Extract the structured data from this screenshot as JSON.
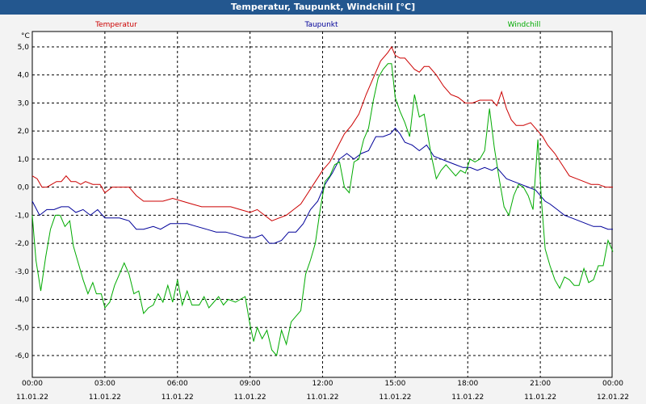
{
  "window": {
    "title": "Temperatur, Taupunkt, Windchill [°C]"
  },
  "colors": {
    "titlebar": "#23578f",
    "plot_bg": "#ffffff",
    "grid": "#000000"
  },
  "chart_data": {
    "type": "line",
    "title": "Temperatur, Taupunkt, Windchill [°C]",
    "unit": "°C",
    "ylim": [
      -6.5,
      5.3
    ],
    "y_ticks": [
      "5,0",
      "4,0",
      "3,0",
      "2,0",
      "1,0",
      "0,0",
      "-1,0",
      "-2,0",
      "-3,0",
      "-4,0",
      "-5,0",
      "-6,0"
    ],
    "y_tick_values": [
      5,
      4,
      3,
      2,
      1,
      0,
      -1,
      -2,
      -3,
      -4,
      -5,
      -6
    ],
    "x_range_hours": [
      0,
      24
    ],
    "x_ticks": [
      {
        "hours": 0,
        "time": "00:00",
        "date": "11.01.22"
      },
      {
        "hours": 3,
        "time": "03:00",
        "date": "11.01.22"
      },
      {
        "hours": 6,
        "time": "06:00",
        "date": "11.01.22"
      },
      {
        "hours": 9,
        "time": "09:00",
        "date": "11.01.22"
      },
      {
        "hours": 12,
        "time": "12:00",
        "date": "11.01.22"
      },
      {
        "hours": 15,
        "time": "15:00",
        "date": "11.01.22"
      },
      {
        "hours": 18,
        "time": "18:00",
        "date": "11.01.22"
      },
      {
        "hours": 21,
        "time": "21:00",
        "date": "11.01.22"
      },
      {
        "hours": 24,
        "time": "00:00",
        "date": "12.01.22"
      }
    ],
    "grid": true,
    "legend_position": "top",
    "series": [
      {
        "name": "Temperatur",
        "color": "#cc0000",
        "points": [
          [
            0,
            0.4
          ],
          [
            0.2,
            0.3
          ],
          [
            0.4,
            0.0
          ],
          [
            0.6,
            0.0
          ],
          [
            0.8,
            0.1
          ],
          [
            1.0,
            0.2
          ],
          [
            1.2,
            0.2
          ],
          [
            1.4,
            0.4
          ],
          [
            1.6,
            0.2
          ],
          [
            1.8,
            0.2
          ],
          [
            2.0,
            0.1
          ],
          [
            2.2,
            0.2
          ],
          [
            2.5,
            0.1
          ],
          [
            2.8,
            0.1
          ],
          [
            3.0,
            -0.2
          ],
          [
            3.3,
            0.0
          ],
          [
            3.6,
            0.0
          ],
          [
            4.0,
            0.0
          ],
          [
            4.3,
            -0.3
          ],
          [
            4.6,
            -0.5
          ],
          [
            5.0,
            -0.5
          ],
          [
            5.4,
            -0.5
          ],
          [
            5.8,
            -0.4
          ],
          [
            6.2,
            -0.5
          ],
          [
            6.6,
            -0.6
          ],
          [
            7.0,
            -0.7
          ],
          [
            7.4,
            -0.7
          ],
          [
            7.8,
            -0.7
          ],
          [
            8.2,
            -0.7
          ],
          [
            8.6,
            -0.8
          ],
          [
            9.0,
            -0.9
          ],
          [
            9.3,
            -0.8
          ],
          [
            9.6,
            -1.0
          ],
          [
            9.9,
            -1.2
          ],
          [
            10.2,
            -1.1
          ],
          [
            10.5,
            -1.0
          ],
          [
            10.8,
            -0.8
          ],
          [
            11.1,
            -0.6
          ],
          [
            11.4,
            -0.2
          ],
          [
            11.7,
            0.2
          ],
          [
            12.0,
            0.6
          ],
          [
            12.3,
            0.9
          ],
          [
            12.6,
            1.4
          ],
          [
            12.9,
            1.9
          ],
          [
            13.2,
            2.2
          ],
          [
            13.5,
            2.6
          ],
          [
            13.8,
            3.3
          ],
          [
            14.1,
            3.9
          ],
          [
            14.4,
            4.5
          ],
          [
            14.7,
            4.8
          ],
          [
            14.85,
            5.0
          ],
          [
            15.0,
            4.7
          ],
          [
            15.2,
            4.6
          ],
          [
            15.4,
            4.6
          ],
          [
            15.6,
            4.4
          ],
          [
            15.8,
            4.2
          ],
          [
            16.0,
            4.1
          ],
          [
            16.2,
            4.3
          ],
          [
            16.4,
            4.3
          ],
          [
            16.7,
            4.0
          ],
          [
            17.0,
            3.6
          ],
          [
            17.3,
            3.3
          ],
          [
            17.6,
            3.2
          ],
          [
            17.9,
            3.0
          ],
          [
            18.2,
            3.0
          ],
          [
            18.5,
            3.1
          ],
          [
            18.8,
            3.1
          ],
          [
            19.0,
            3.1
          ],
          [
            19.2,
            2.9
          ],
          [
            19.4,
            3.4
          ],
          [
            19.6,
            2.8
          ],
          [
            19.8,
            2.4
          ],
          [
            20.0,
            2.2
          ],
          [
            20.3,
            2.2
          ],
          [
            20.6,
            2.3
          ],
          [
            20.9,
            2.0
          ],
          [
            21.1,
            1.8
          ],
          [
            21.3,
            1.5
          ],
          [
            21.6,
            1.2
          ],
          [
            21.9,
            0.8
          ],
          [
            22.2,
            0.4
          ],
          [
            22.5,
            0.3
          ],
          [
            22.8,
            0.2
          ],
          [
            23.1,
            0.1
          ],
          [
            23.4,
            0.1
          ],
          [
            23.7,
            0.0
          ],
          [
            24.0,
            0.0
          ]
        ]
      },
      {
        "name": "Taupunkt",
        "color": "#000099",
        "points": [
          [
            0,
            -0.5
          ],
          [
            0.3,
            -1.0
          ],
          [
            0.6,
            -0.8
          ],
          [
            0.9,
            -0.8
          ],
          [
            1.2,
            -0.7
          ],
          [
            1.5,
            -0.7
          ],
          [
            1.8,
            -0.9
          ],
          [
            2.1,
            -0.8
          ],
          [
            2.4,
            -1.0
          ],
          [
            2.7,
            -0.8
          ],
          [
            3.0,
            -1.1
          ],
          [
            3.3,
            -1.1
          ],
          [
            3.6,
            -1.1
          ],
          [
            4.0,
            -1.2
          ],
          [
            4.3,
            -1.5
          ],
          [
            4.6,
            -1.5
          ],
          [
            5.0,
            -1.4
          ],
          [
            5.3,
            -1.5
          ],
          [
            5.7,
            -1.3
          ],
          [
            6.0,
            -1.3
          ],
          [
            6.4,
            -1.3
          ],
          [
            6.8,
            -1.4
          ],
          [
            7.2,
            -1.5
          ],
          [
            7.6,
            -1.6
          ],
          [
            8.0,
            -1.6
          ],
          [
            8.4,
            -1.7
          ],
          [
            8.8,
            -1.8
          ],
          [
            9.2,
            -1.8
          ],
          [
            9.5,
            -1.7
          ],
          [
            9.8,
            -2.0
          ],
          [
            10.0,
            -2.0
          ],
          [
            10.3,
            -1.9
          ],
          [
            10.6,
            -1.6
          ],
          [
            10.9,
            -1.6
          ],
          [
            11.2,
            -1.3
          ],
          [
            11.5,
            -0.8
          ],
          [
            11.8,
            -0.5
          ],
          [
            12.1,
            0.1
          ],
          [
            12.4,
            0.5
          ],
          [
            12.7,
            1.0
          ],
          [
            13.0,
            1.2
          ],
          [
            13.3,
            1.0
          ],
          [
            13.6,
            1.2
          ],
          [
            13.9,
            1.3
          ],
          [
            14.2,
            1.8
          ],
          [
            14.5,
            1.8
          ],
          [
            14.8,
            1.9
          ],
          [
            15.0,
            2.1
          ],
          [
            15.2,
            1.9
          ],
          [
            15.4,
            1.6
          ],
          [
            15.7,
            1.5
          ],
          [
            16.0,
            1.3
          ],
          [
            16.3,
            1.5
          ],
          [
            16.6,
            1.1
          ],
          [
            16.9,
            1.0
          ],
          [
            17.2,
            0.9
          ],
          [
            17.5,
            0.8
          ],
          [
            17.8,
            0.7
          ],
          [
            18.1,
            0.7
          ],
          [
            18.4,
            0.6
          ],
          [
            18.7,
            0.7
          ],
          [
            19.0,
            0.6
          ],
          [
            19.2,
            0.7
          ],
          [
            19.4,
            0.5
          ],
          [
            19.6,
            0.3
          ],
          [
            19.9,
            0.2
          ],
          [
            20.2,
            0.1
          ],
          [
            20.5,
            0.0
          ],
          [
            20.8,
            -0.1
          ],
          [
            21.0,
            -0.3
          ],
          [
            21.2,
            -0.5
          ],
          [
            21.4,
            -0.6
          ],
          [
            21.7,
            -0.8
          ],
          [
            22.0,
            -1.0
          ],
          [
            22.3,
            -1.1
          ],
          [
            22.6,
            -1.2
          ],
          [
            22.9,
            -1.3
          ],
          [
            23.2,
            -1.4
          ],
          [
            23.5,
            -1.4
          ],
          [
            23.8,
            -1.5
          ],
          [
            24.0,
            -1.5
          ]
        ]
      },
      {
        "name": "Windchill",
        "color": "#00aa00",
        "points": [
          [
            0,
            -1.0
          ],
          [
            0.15,
            -2.6
          ],
          [
            0.35,
            -3.7
          ],
          [
            0.55,
            -2.5
          ],
          [
            0.75,
            -1.5
          ],
          [
            0.95,
            -1.0
          ],
          [
            1.15,
            -1.0
          ],
          [
            1.35,
            -1.4
          ],
          [
            1.55,
            -1.2
          ],
          [
            1.7,
            -2.1
          ],
          [
            1.9,
            -2.7
          ],
          [
            2.1,
            -3.3
          ],
          [
            2.3,
            -3.8
          ],
          [
            2.5,
            -3.4
          ],
          [
            2.65,
            -3.8
          ],
          [
            2.85,
            -3.8
          ],
          [
            3.0,
            -4.3
          ],
          [
            3.2,
            -4.1
          ],
          [
            3.4,
            -3.5
          ],
          [
            3.6,
            -3.1
          ],
          [
            3.8,
            -2.7
          ],
          [
            4.0,
            -3.1
          ],
          [
            4.2,
            -3.8
          ],
          [
            4.4,
            -3.7
          ],
          [
            4.6,
            -4.5
          ],
          [
            4.8,
            -4.3
          ],
          [
            5.0,
            -4.2
          ],
          [
            5.2,
            -3.8
          ],
          [
            5.4,
            -4.1
          ],
          [
            5.6,
            -3.5
          ],
          [
            5.8,
            -4.1
          ],
          [
            6.0,
            -3.3
          ],
          [
            6.2,
            -4.2
          ],
          [
            6.4,
            -3.7
          ],
          [
            6.6,
            -4.2
          ],
          [
            6.9,
            -4.2
          ],
          [
            7.1,
            -3.9
          ],
          [
            7.3,
            -4.3
          ],
          [
            7.5,
            -4.1
          ],
          [
            7.7,
            -3.9
          ],
          [
            7.9,
            -4.2
          ],
          [
            8.1,
            -4.0
          ],
          [
            8.4,
            -4.1
          ],
          [
            8.6,
            -4.0
          ],
          [
            8.8,
            -3.9
          ],
          [
            9.0,
            -4.9
          ],
          [
            9.15,
            -5.5
          ],
          [
            9.3,
            -5.0
          ],
          [
            9.5,
            -5.4
          ],
          [
            9.7,
            -5.1
          ],
          [
            9.9,
            -5.8
          ],
          [
            10.1,
            -6.0
          ],
          [
            10.3,
            -5.1
          ],
          [
            10.5,
            -5.6
          ],
          [
            10.7,
            -4.8
          ],
          [
            10.9,
            -4.6
          ],
          [
            11.1,
            -4.4
          ],
          [
            11.3,
            -3.1
          ],
          [
            11.5,
            -2.6
          ],
          [
            11.7,
            -2.0
          ],
          [
            11.9,
            -0.8
          ],
          [
            12.1,
            0.2
          ],
          [
            12.3,
            0.4
          ],
          [
            12.5,
            0.8
          ],
          [
            12.7,
            0.9
          ],
          [
            12.9,
            0.0
          ],
          [
            13.1,
            -0.2
          ],
          [
            13.3,
            0.9
          ],
          [
            13.5,
            1.0
          ],
          [
            13.7,
            1.7
          ],
          [
            13.9,
            2.1
          ],
          [
            14.1,
            3.1
          ],
          [
            14.3,
            3.9
          ],
          [
            14.5,
            4.2
          ],
          [
            14.7,
            4.4
          ],
          [
            14.85,
            4.4
          ],
          [
            15.0,
            3.2
          ],
          [
            15.2,
            2.7
          ],
          [
            15.4,
            2.3
          ],
          [
            15.6,
            1.8
          ],
          [
            15.8,
            3.3
          ],
          [
            16.0,
            2.5
          ],
          [
            16.2,
            2.6
          ],
          [
            16.5,
            1.1
          ],
          [
            16.7,
            0.3
          ],
          [
            16.9,
            0.6
          ],
          [
            17.1,
            0.8
          ],
          [
            17.3,
            0.6
          ],
          [
            17.5,
            0.4
          ],
          [
            17.7,
            0.6
          ],
          [
            17.9,
            0.5
          ],
          [
            18.1,
            1.0
          ],
          [
            18.3,
            0.9
          ],
          [
            18.5,
            1.0
          ],
          [
            18.7,
            1.3
          ],
          [
            18.9,
            2.8
          ],
          [
            19.1,
            1.4
          ],
          [
            19.3,
            0.3
          ],
          [
            19.5,
            -0.7
          ],
          [
            19.7,
            -1.0
          ],
          [
            19.9,
            -0.3
          ],
          [
            20.1,
            0.1
          ],
          [
            20.3,
            0.0
          ],
          [
            20.5,
            -0.3
          ],
          [
            20.7,
            -0.8
          ],
          [
            20.9,
            1.7
          ],
          [
            21.05,
            -0.5
          ],
          [
            21.2,
            -2.2
          ],
          [
            21.4,
            -2.8
          ],
          [
            21.6,
            -3.3
          ],
          [
            21.8,
            -3.6
          ],
          [
            22.0,
            -3.2
          ],
          [
            22.2,
            -3.3
          ],
          [
            22.4,
            -3.5
          ],
          [
            22.6,
            -3.5
          ],
          [
            22.8,
            -2.9
          ],
          [
            23.0,
            -3.4
          ],
          [
            23.2,
            -3.3
          ],
          [
            23.4,
            -2.8
          ],
          [
            23.6,
            -2.8
          ],
          [
            23.8,
            -1.9
          ],
          [
            24.0,
            -2.3
          ]
        ]
      }
    ]
  }
}
